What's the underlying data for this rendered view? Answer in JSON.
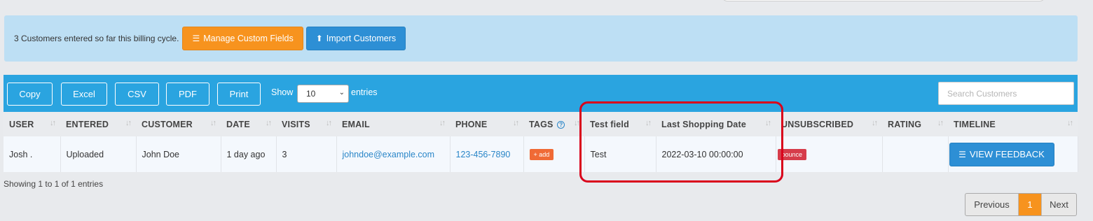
{
  "info_bar": {
    "text": "3 Customers entered so far this billing cycle.",
    "manage_label": "Manage Custom Fields",
    "import_label": "Import Customers"
  },
  "toolbar": {
    "buttons": [
      "Copy",
      "Excel",
      "CSV",
      "PDF",
      "Print"
    ],
    "show_label": "Show",
    "entries_value": "10",
    "entries_label": "entries",
    "search_placeholder": "Search Customers"
  },
  "table": {
    "columns": [
      "USER",
      "ENTERED",
      "CUSTOMER",
      "DATE",
      "VISITS",
      "EMAIL",
      "PHONE",
      "TAGS",
      "Test field",
      "Last Shopping Date",
      "UNSUBSCRIBED",
      "RATING",
      "TIMELINE"
    ],
    "rows": [
      {
        "user": "Josh .",
        "entered": "Uploaded",
        "customer": "John Doe",
        "date": "1 day ago",
        "visits": "3",
        "email": "johndoe@example.com",
        "phone": "123-456-7890",
        "tag_button": "+ add",
        "test_field": "Test",
        "last_shopping_date": "2022-03-10 00:00:00",
        "unsubscribed_badge": "bounce",
        "rating": "",
        "timeline_button": "VIEW FEEDBACK"
      }
    ]
  },
  "footer": {
    "showing": "Showing 1 to 1 of 1 entries",
    "prev": "Previous",
    "current_page": "1",
    "next": "Next"
  },
  "colors": {
    "accent_orange": "#f7931e",
    "accent_blue": "#2d8fd5",
    "toolbar_blue": "#2aa4e0",
    "info_bg": "#bddff4",
    "highlight_red": "#d9001b"
  },
  "icons": {
    "manage": "list-icon",
    "import": "upload-icon",
    "feedback": "list-icon",
    "tags_help": "question-icon"
  }
}
